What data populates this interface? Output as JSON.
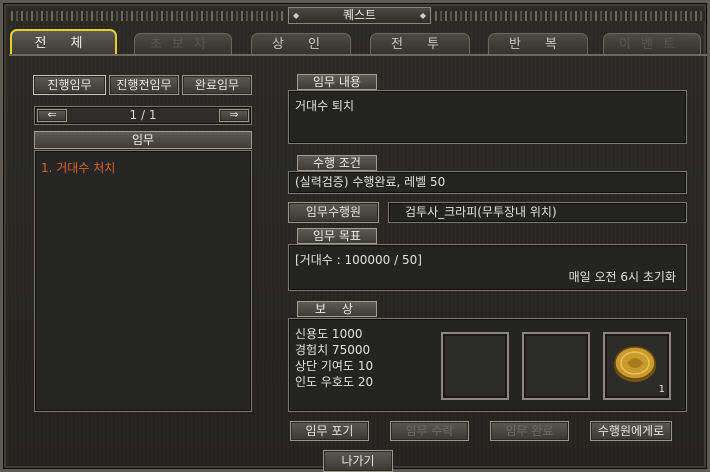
{
  "window": {
    "title": "퀘스트"
  },
  "tabs": [
    {
      "label": "전 체",
      "state": "active"
    },
    {
      "label": "초보자",
      "state": "disabled"
    },
    {
      "label": "상 인",
      "state": "normal"
    },
    {
      "label": "전 투",
      "state": "normal"
    },
    {
      "label": "반 복",
      "state": "normal"
    },
    {
      "label": "이벤트",
      "state": "disabled"
    }
  ],
  "left": {
    "subtabs": [
      "진행임무",
      "진행전임무",
      "완료임무"
    ],
    "pager": "1 / 1",
    "list_header": "임무",
    "items": [
      "1. 거대수 처치"
    ]
  },
  "detail": {
    "content_label": "임무 내용",
    "content": "거대수 퇴치",
    "condition_label": "수행 조건",
    "condition": "(실력검증) 수행완료, 레벨 50",
    "giver_label": "임무수행원",
    "giver": "검투사_크라피(무투장내 위치)",
    "goal_label": "임무 목표",
    "goal": "[거대수 : 100000 / 50]",
    "reset": "매일 오전 6시 초기화",
    "reward_label": "보 상",
    "rewards": [
      "신용도 1000",
      "경험치 75000",
      "상단 기여도 10",
      "인도 우호도 20"
    ],
    "reward_item_count": "1"
  },
  "actions": {
    "abandon": "임무 포기",
    "accept": "임무 수락",
    "complete": "임무 완료",
    "to_giver": "수행원에게로"
  },
  "exit": "나가기",
  "colors": {
    "accent_tab": "#e7d21d",
    "quest_item": "#e0622a",
    "coin": "#c99a2c"
  }
}
